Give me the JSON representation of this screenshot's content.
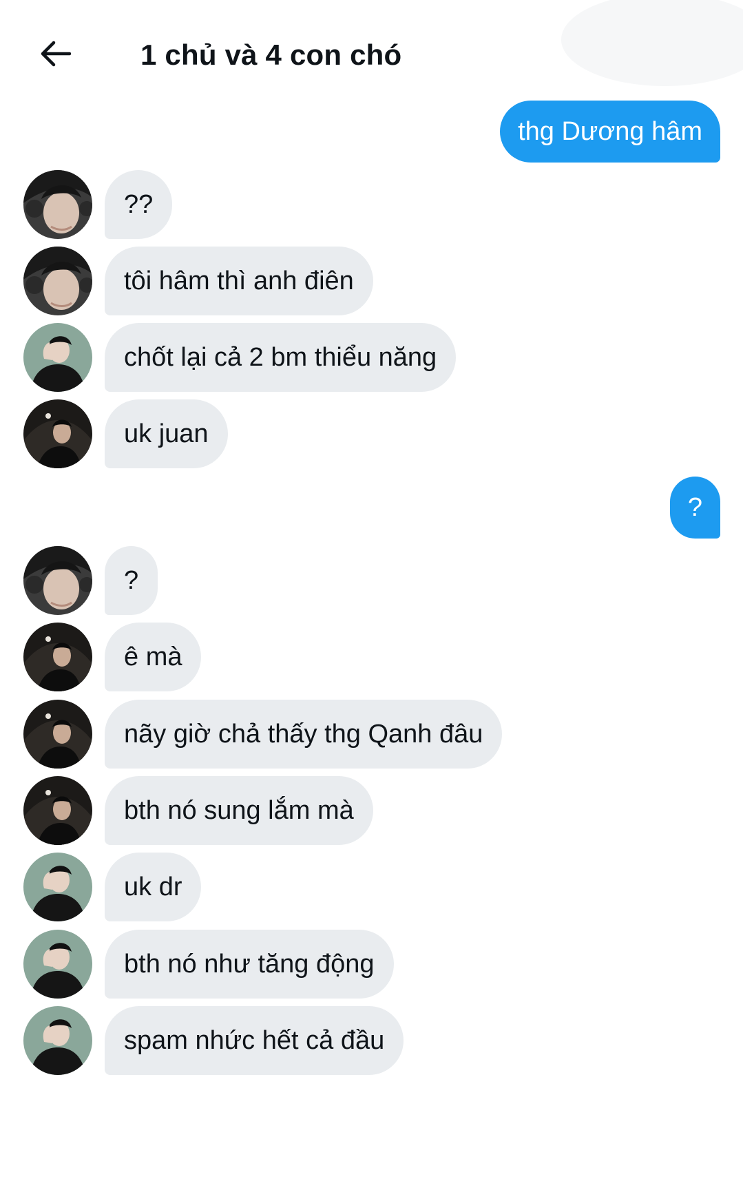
{
  "header": {
    "title": "1 chủ và 4 con chó",
    "back_icon": "arrow-left-icon"
  },
  "colors": {
    "outgoing_bubble": "#1d9bf0",
    "incoming_bubble": "#e9ecef",
    "text": "#0f1419"
  },
  "messages": [
    {
      "direction": "outgoing",
      "text": "thg Dương hâm"
    },
    {
      "direction": "incoming",
      "avatar": "avatar-headphones",
      "text": "??"
    },
    {
      "direction": "incoming",
      "avatar": "avatar-headphones",
      "text": "tôi hâm thì anh điên"
    },
    {
      "direction": "incoming",
      "avatar": "avatar-green-bg",
      "text": "chốt lại cả 2 bm thiểu năng"
    },
    {
      "direction": "incoming",
      "avatar": "avatar-dark",
      "text": "uk juan"
    },
    {
      "direction": "outgoing",
      "text": "?"
    },
    {
      "direction": "incoming",
      "avatar": "avatar-headphones",
      "text": "?"
    },
    {
      "direction": "incoming",
      "avatar": "avatar-dark",
      "text": "ê mà"
    },
    {
      "direction": "incoming",
      "avatar": "avatar-dark",
      "text": "nãy giờ chả thấy thg Qanh đâu"
    },
    {
      "direction": "incoming",
      "avatar": "avatar-dark",
      "text": "bth nó sung lắm mà"
    },
    {
      "direction": "incoming",
      "avatar": "avatar-green-bg",
      "text": "uk dr"
    },
    {
      "direction": "incoming",
      "avatar": "avatar-green-bg",
      "text": "bth nó như tăng động"
    },
    {
      "direction": "incoming",
      "avatar": "avatar-green-bg",
      "text": "spam nhức hết cả đầu"
    }
  ]
}
